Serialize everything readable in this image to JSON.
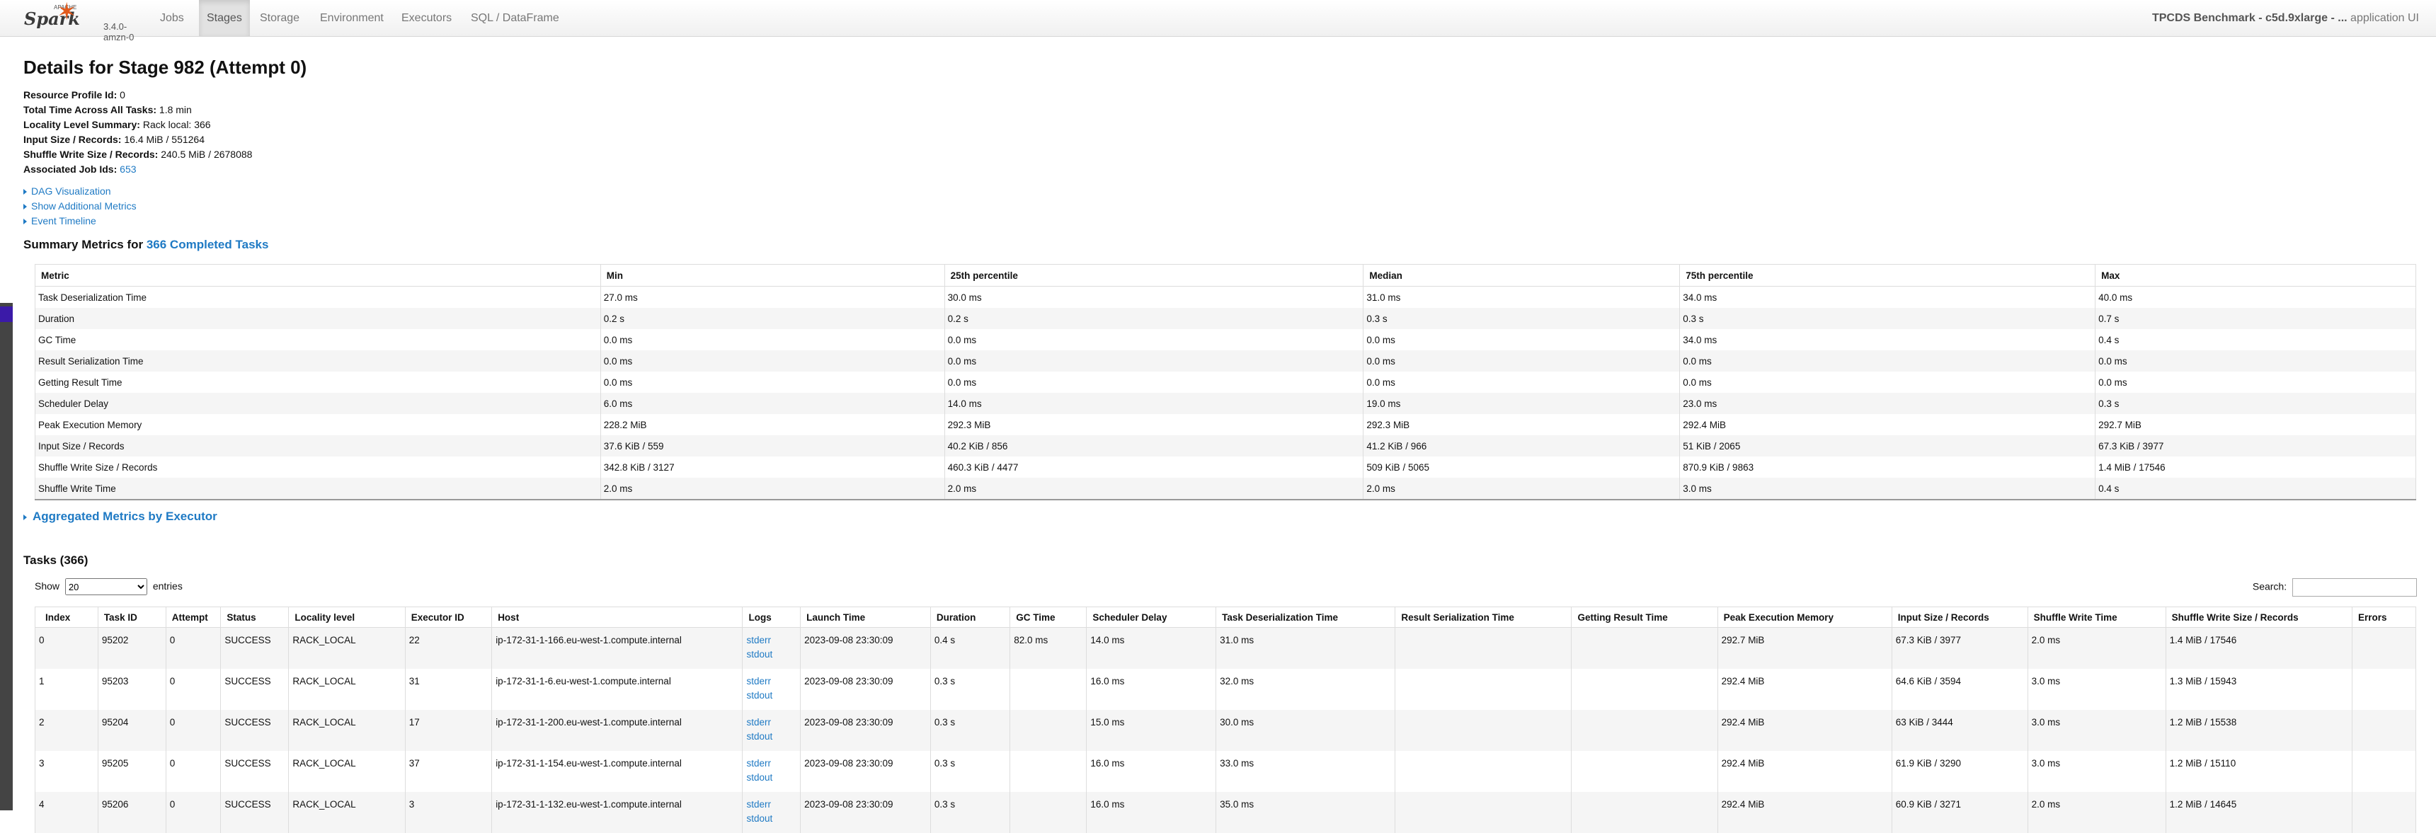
{
  "nav": {
    "brand": "Spark",
    "apache": "APACHE",
    "version": "3.4.0-amzn-0",
    "items": [
      "Jobs",
      "Stages",
      "Storage",
      "Environment",
      "Executors",
      "SQL / DataFrame"
    ],
    "active": "Stages",
    "app_title": "TPCDS Benchmark - c5d.9xlarge - ...",
    "app_suffix": " application UI"
  },
  "stage": {
    "title": "Details for Stage 982 (Attempt 0)",
    "info": [
      {
        "label": "Resource Profile Id:",
        "value": "0"
      },
      {
        "label": "Total Time Across All Tasks:",
        "value": "1.8 min"
      },
      {
        "label": "Locality Level Summary:",
        "value": "Rack local: 366"
      },
      {
        "label": "Input Size / Records:",
        "value": "16.4 MiB / 551264"
      },
      {
        "label": "Shuffle Write Size / Records:",
        "value": "240.5 MiB / 2678088"
      },
      {
        "label": "Associated Job Ids:",
        "value": "653"
      }
    ]
  },
  "toggles": [
    "DAG Visualization",
    "Show Additional Metrics",
    "Event Timeline"
  ],
  "summary": {
    "prefix": "Summary Metrics for ",
    "link": "366 Completed Tasks",
    "headers": [
      "Metric",
      "Min",
      "25th percentile",
      "Median",
      "75th percentile",
      "Max"
    ],
    "rows": [
      [
        "Task Deserialization Time",
        "27.0 ms",
        "30.0 ms",
        "31.0 ms",
        "34.0 ms",
        "40.0 ms"
      ],
      [
        "Duration",
        "0.2 s",
        "0.2 s",
        "0.3 s",
        "0.3 s",
        "0.7 s"
      ],
      [
        "GC Time",
        "0.0 ms",
        "0.0 ms",
        "0.0 ms",
        "34.0 ms",
        "0.4 s"
      ],
      [
        "Result Serialization Time",
        "0.0 ms",
        "0.0 ms",
        "0.0 ms",
        "0.0 ms",
        "0.0 ms"
      ],
      [
        "Getting Result Time",
        "0.0 ms",
        "0.0 ms",
        "0.0 ms",
        "0.0 ms",
        "0.0 ms"
      ],
      [
        "Scheduler Delay",
        "6.0 ms",
        "14.0 ms",
        "19.0 ms",
        "23.0 ms",
        "0.3 s"
      ],
      [
        "Peak Execution Memory",
        "228.2 MiB",
        "292.3 MiB",
        "292.3 MiB",
        "292.4 MiB",
        "292.7 MiB"
      ],
      [
        "Input Size / Records",
        "37.6 KiB / 559",
        "40.2 KiB / 856",
        "41.2 KiB / 966",
        "51 KiB / 2065",
        "67.3 KiB / 3977"
      ],
      [
        "Shuffle Write Size / Records",
        "342.8 KiB / 3127",
        "460.3 KiB / 4477",
        "509 KiB / 5065",
        "870.9 KiB / 9863",
        "1.4 MiB / 17546"
      ],
      [
        "Shuffle Write Time",
        "2.0 ms",
        "2.0 ms",
        "2.0 ms",
        "3.0 ms",
        "0.4 s"
      ]
    ]
  },
  "aggregated": "Aggregated Metrics by Executor",
  "tasks": {
    "title": "Tasks (366)",
    "show_label": "Show",
    "show_value": "20",
    "entries_label": "entries",
    "search_label": "Search:",
    "search_value": "",
    "headers": [
      "Index",
      "Task ID",
      "Attempt",
      "Status",
      "Locality level",
      "Executor ID",
      "Host",
      "Logs",
      "Launch Time",
      "Duration",
      "GC Time",
      "Scheduler Delay",
      "Task Deserialization Time",
      "Result Serialization Time",
      "Getting Result Time",
      "Peak Execution Memory",
      "Input Size / Records",
      "Shuffle Write Time",
      "Shuffle Write Size / Records",
      "Errors"
    ],
    "log_links": [
      "stderr",
      "stdout"
    ],
    "rows": [
      [
        "0",
        "95202",
        "0",
        "SUCCESS",
        "RACK_LOCAL",
        "22",
        "ip-172-31-1-166.eu-west-1.compute.internal",
        "",
        "2023-09-08 23:30:09",
        "0.4 s",
        "82.0 ms",
        "14.0 ms",
        "31.0 ms",
        "",
        "",
        "292.7 MiB",
        "67.3 KiB / 3977",
        "2.0 ms",
        "1.4 MiB / 17546",
        ""
      ],
      [
        "1",
        "95203",
        "0",
        "SUCCESS",
        "RACK_LOCAL",
        "31",
        "ip-172-31-1-6.eu-west-1.compute.internal",
        "",
        "2023-09-08 23:30:09",
        "0.3 s",
        "",
        "16.0 ms",
        "32.0 ms",
        "",
        "",
        "292.4 MiB",
        "64.6 KiB / 3594",
        "3.0 ms",
        "1.3 MiB / 15943",
        ""
      ],
      [
        "2",
        "95204",
        "0",
        "SUCCESS",
        "RACK_LOCAL",
        "17",
        "ip-172-31-1-200.eu-west-1.compute.internal",
        "",
        "2023-09-08 23:30:09",
        "0.3 s",
        "",
        "15.0 ms",
        "30.0 ms",
        "",
        "",
        "292.4 MiB",
        "63 KiB / 3444",
        "3.0 ms",
        "1.2 MiB / 15538",
        ""
      ],
      [
        "3",
        "95205",
        "0",
        "SUCCESS",
        "RACK_LOCAL",
        "37",
        "ip-172-31-1-154.eu-west-1.compute.internal",
        "",
        "2023-09-08 23:30:09",
        "0.3 s",
        "",
        "16.0 ms",
        "33.0 ms",
        "",
        "",
        "292.4 MiB",
        "61.9 KiB / 3290",
        "3.0 ms",
        "1.2 MiB / 15110",
        ""
      ],
      [
        "4",
        "95206",
        "0",
        "SUCCESS",
        "RACK_LOCAL",
        "3",
        "ip-172-31-1-132.eu-west-1.compute.internal",
        "",
        "2023-09-08 23:30:09",
        "0.3 s",
        "",
        "16.0 ms",
        "35.0 ms",
        "",
        "",
        "292.4 MiB",
        "60.9 KiB / 3271",
        "2.0 ms",
        "1.2 MiB / 14645",
        ""
      ]
    ]
  }
}
